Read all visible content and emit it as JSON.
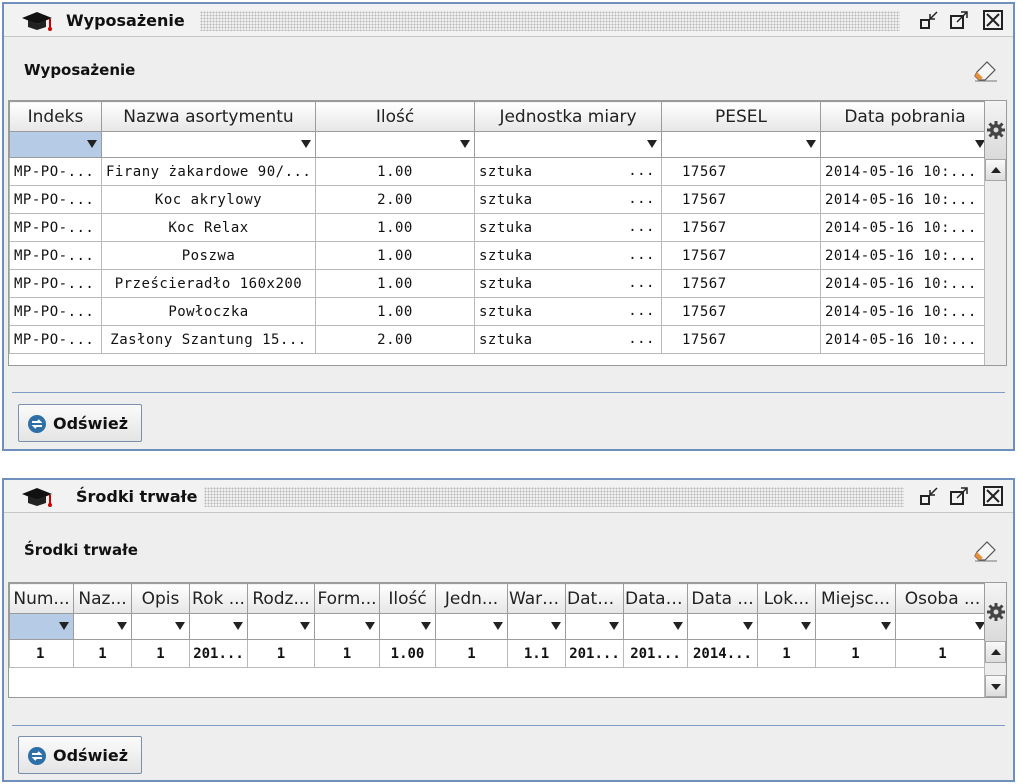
{
  "panel1": {
    "title": "Wyposażenie",
    "subtitle": "Wyposażenie",
    "icons": {
      "app": "graduation-cap-icon",
      "minimize": "minimize-icon",
      "maximize": "maximize-icon",
      "close": "close-icon",
      "clear": "eraser-icon",
      "settings": "gear-icon",
      "refresh": "refresh-icon"
    },
    "columns": [
      "Indeks",
      "Nazwa asortymentu",
      "Ilość",
      "Jednostka miary",
      "PESEL",
      "Data pobrania"
    ],
    "rows": [
      [
        "MP-PO-...",
        "Firany żakardowe 90/...",
        "1.00",
        "sztuka",
        "17567",
        "2014-05-16 10:..."
      ],
      [
        "MP-PO-...",
        "Koc akrylowy",
        "2.00",
        "sztuka",
        "17567",
        "2014-05-16 10:..."
      ],
      [
        "MP-PO-...",
        "Koc Relax",
        "1.00",
        "sztuka",
        "17567",
        "2014-05-16 10:..."
      ],
      [
        "MP-PO-...",
        "Poszwa",
        "1.00",
        "sztuka",
        "17567",
        "2014-05-16 10:..."
      ],
      [
        "MP-PO-...",
        "Prześcieradło 160x200",
        "1.00",
        "sztuka",
        "17567",
        "2014-05-16 10:..."
      ],
      [
        "MP-PO-...",
        "Powłoczka",
        "1.00",
        "sztuka",
        "17567",
        "2014-05-16 10:..."
      ],
      [
        "MP-PO-...",
        "Zasłony Szantung 15...",
        "2.00",
        "sztuka",
        "17567",
        "2014-05-16 10:..."
      ]
    ],
    "unit_ellipsis": "...",
    "refresh_label": "Odśwież"
  },
  "panel2": {
    "title": "Środki trwałe",
    "subtitle": "Środki trwałe",
    "columns": [
      "Num...",
      "Naz...",
      "Opis",
      "Rok ...",
      "Rodz...",
      "Form...",
      "Ilość",
      "Jedn...",
      "Wart...",
      "Data...",
      "Data ...",
      "Data ...",
      "Lok...",
      "Miejsc...",
      "Osoba ..."
    ],
    "rows": [
      [
        "1",
        "1",
        "1",
        "201...",
        "1",
        "1",
        "1.00",
        "1",
        "1.1",
        "201...",
        "201...",
        "2014...",
        "1",
        "1",
        "1"
      ]
    ],
    "refresh_label": "Odśwież"
  },
  "colors": {
    "border": "#6f8fbf",
    "filter_selected": "#b6cbe5",
    "panel_bg": "#eeeeee"
  }
}
